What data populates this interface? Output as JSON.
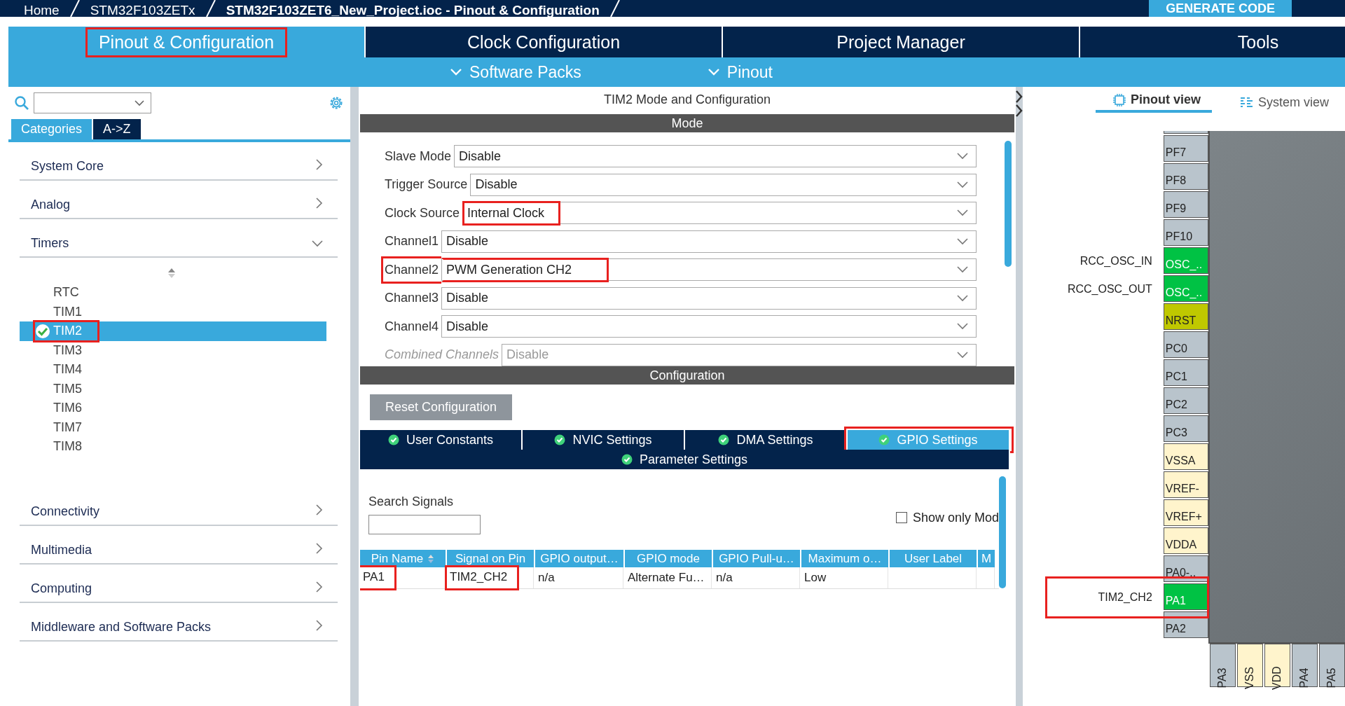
{
  "breadcrumbs": [
    "Home",
    "STM32F103ZETx",
    "STM32F103ZET6_New_Project.ioc - Pinout & Configuration"
  ],
  "generate_button": "GENERATE CODE",
  "main_tabs": [
    {
      "label": "Pinout & Configuration",
      "selected": true,
      "highlighted": true
    },
    {
      "label": "Clock Configuration",
      "selected": false,
      "highlighted": false
    },
    {
      "label": "Project Manager",
      "selected": false,
      "highlighted": false
    },
    {
      "label": "Tools",
      "selected": false,
      "highlighted": false
    }
  ],
  "sub_menus": [
    "Software Packs",
    "Pinout"
  ],
  "sidebar": {
    "tabs": [
      {
        "label": "Categories",
        "selected": true
      },
      {
        "label": "A->Z",
        "selected": false
      }
    ],
    "categories": [
      {
        "label": "System Core",
        "expanded": false
      },
      {
        "label": "Analog",
        "expanded": false
      },
      {
        "label": "Timers",
        "expanded": true,
        "children": [
          {
            "label": "RTC",
            "selected": false,
            "configured": false,
            "highlighted": false
          },
          {
            "label": "TIM1",
            "selected": false,
            "configured": false,
            "highlighted": false
          },
          {
            "label": "TIM2",
            "selected": true,
            "configured": true,
            "highlighted": true
          },
          {
            "label": "TIM3",
            "selected": false,
            "configured": false,
            "highlighted": false
          },
          {
            "label": "TIM4",
            "selected": false,
            "configured": false,
            "highlighted": false
          },
          {
            "label": "TIM5",
            "selected": false,
            "configured": false,
            "highlighted": false
          },
          {
            "label": "TIM6",
            "selected": false,
            "configured": false,
            "highlighted": false
          },
          {
            "label": "TIM7",
            "selected": false,
            "configured": false,
            "highlighted": false
          },
          {
            "label": "TIM8",
            "selected": false,
            "configured": false,
            "highlighted": false
          }
        ]
      },
      {
        "label": "Connectivity",
        "expanded": false
      },
      {
        "label": "Multimedia",
        "expanded": false
      },
      {
        "label": "Computing",
        "expanded": false
      },
      {
        "label": "Middleware and Software Packs",
        "expanded": false
      }
    ]
  },
  "mode_panel": {
    "title": "TIM2 Mode and Configuration",
    "header": "Mode",
    "fields": [
      {
        "label": "Slave Mode",
        "value": "Disable",
        "disabled": false,
        "label_highlighted": false,
        "value_highlighted": false
      },
      {
        "label": "Trigger Source",
        "value": "Disable",
        "disabled": false,
        "label_highlighted": false,
        "value_highlighted": false
      },
      {
        "label": "Clock Source",
        "value": "Internal Clock",
        "disabled": false,
        "label_highlighted": false,
        "value_highlighted": true
      },
      {
        "label": "Channel1",
        "value": "Disable",
        "disabled": false,
        "label_highlighted": false,
        "value_highlighted": false
      },
      {
        "label": "Channel2",
        "value": "PWM Generation CH2",
        "disabled": false,
        "label_highlighted": true,
        "value_highlighted": true
      },
      {
        "label": "Channel3",
        "value": "Disable",
        "disabled": false,
        "label_highlighted": false,
        "value_highlighted": false
      },
      {
        "label": "Channel4",
        "value": "Disable",
        "disabled": false,
        "label_highlighted": false,
        "value_highlighted": false
      },
      {
        "label": "Combined Channels",
        "value": "Disable",
        "disabled": true,
        "label_highlighted": false,
        "value_highlighted": false
      }
    ]
  },
  "config_panel": {
    "header": "Configuration",
    "reset_button": "Reset Configuration",
    "tabs": [
      {
        "label": "User Constants",
        "selected": false,
        "highlighted": false
      },
      {
        "label": "NVIC Settings",
        "selected": false,
        "highlighted": false
      },
      {
        "label": "DMA Settings",
        "selected": false,
        "highlighted": false
      },
      {
        "label": "GPIO Settings",
        "selected": true,
        "highlighted": true
      }
    ],
    "second_row_tabs": [
      {
        "label": "Parameter Settings",
        "selected": false,
        "highlighted": false
      }
    ],
    "search_label": "Search Signals",
    "show_only_checkbox": {
      "label": "Show only Mod",
      "checked": false
    },
    "table": {
      "columns": [
        "Pin Name",
        "Signal on Pin",
        "GPIO output…",
        "GPIO mode",
        "GPIO Pull-u…",
        "Maximum o…",
        "User Label",
        "M"
      ],
      "rows": [
        {
          "cells": [
            {
              "text": "PA1",
              "highlighted": true
            },
            {
              "text": "TIM2_CH2",
              "highlighted": true
            },
            {
              "text": "n/a",
              "highlighted": false
            },
            {
              "text": "Alternate Fu…",
              "highlighted": false
            },
            {
              "text": "n/a",
              "highlighted": false
            },
            {
              "text": "Low",
              "highlighted": false
            }
          ]
        }
      ]
    }
  },
  "pinout": {
    "view_tabs": [
      {
        "label": "Pinout view",
        "selected": true
      },
      {
        "label": "System view",
        "selected": false
      }
    ],
    "left_pins": [
      {
        "label": "PF7",
        "color": "#b9c4cc",
        "highlighted": false
      },
      {
        "label": "PF8",
        "color": "#b9c4cc",
        "highlighted": false
      },
      {
        "label": "PF9",
        "color": "#b9c4cc",
        "highlighted": false
      },
      {
        "label": "PF10",
        "color": "#b9c4cc",
        "highlighted": false
      },
      {
        "label": "OSC_..",
        "color": "#00c244",
        "signal": "RCC_OSC_IN",
        "highlighted": false
      },
      {
        "label": "OSC_..",
        "color": "#00c244",
        "signal": "RCC_OSC_OUT",
        "highlighted": false
      },
      {
        "label": "NRST",
        "color": "#bfc800",
        "highlighted": false
      },
      {
        "label": "PC0",
        "color": "#b9c4cc",
        "highlighted": false
      },
      {
        "label": "PC1",
        "color": "#b9c4cc",
        "highlighted": false
      },
      {
        "label": "PC2",
        "color": "#b9c4cc",
        "highlighted": false
      },
      {
        "label": "PC3",
        "color": "#b9c4cc",
        "highlighted": false
      },
      {
        "label": "VSSA",
        "color": "#fff4cc",
        "highlighted": false
      },
      {
        "label": "VREF-",
        "color": "#fff4cc",
        "highlighted": false
      },
      {
        "label": "VREF+",
        "color": "#fff4cc",
        "highlighted": false
      },
      {
        "label": "VDDA",
        "color": "#fff4cc",
        "highlighted": false
      },
      {
        "label": "PA0-..",
        "color": "#b9c4cc",
        "highlighted": false
      },
      {
        "label": "PA1",
        "color": "#00c244",
        "signal": "TIM2_CH2",
        "highlighted": true
      },
      {
        "label": "PA2",
        "color": "#b9c4cc",
        "highlighted": false
      }
    ],
    "bottom_pins": [
      {
        "label": "PA3",
        "color": "#b9c4cc"
      },
      {
        "label": "VSS",
        "color": "#fff4cc"
      },
      {
        "label": "VDD",
        "color": "#fff4cc"
      },
      {
        "label": "PA4",
        "color": "#b9c4cc"
      },
      {
        "label": "PA5",
        "color": "#b9c4cc"
      }
    ]
  }
}
